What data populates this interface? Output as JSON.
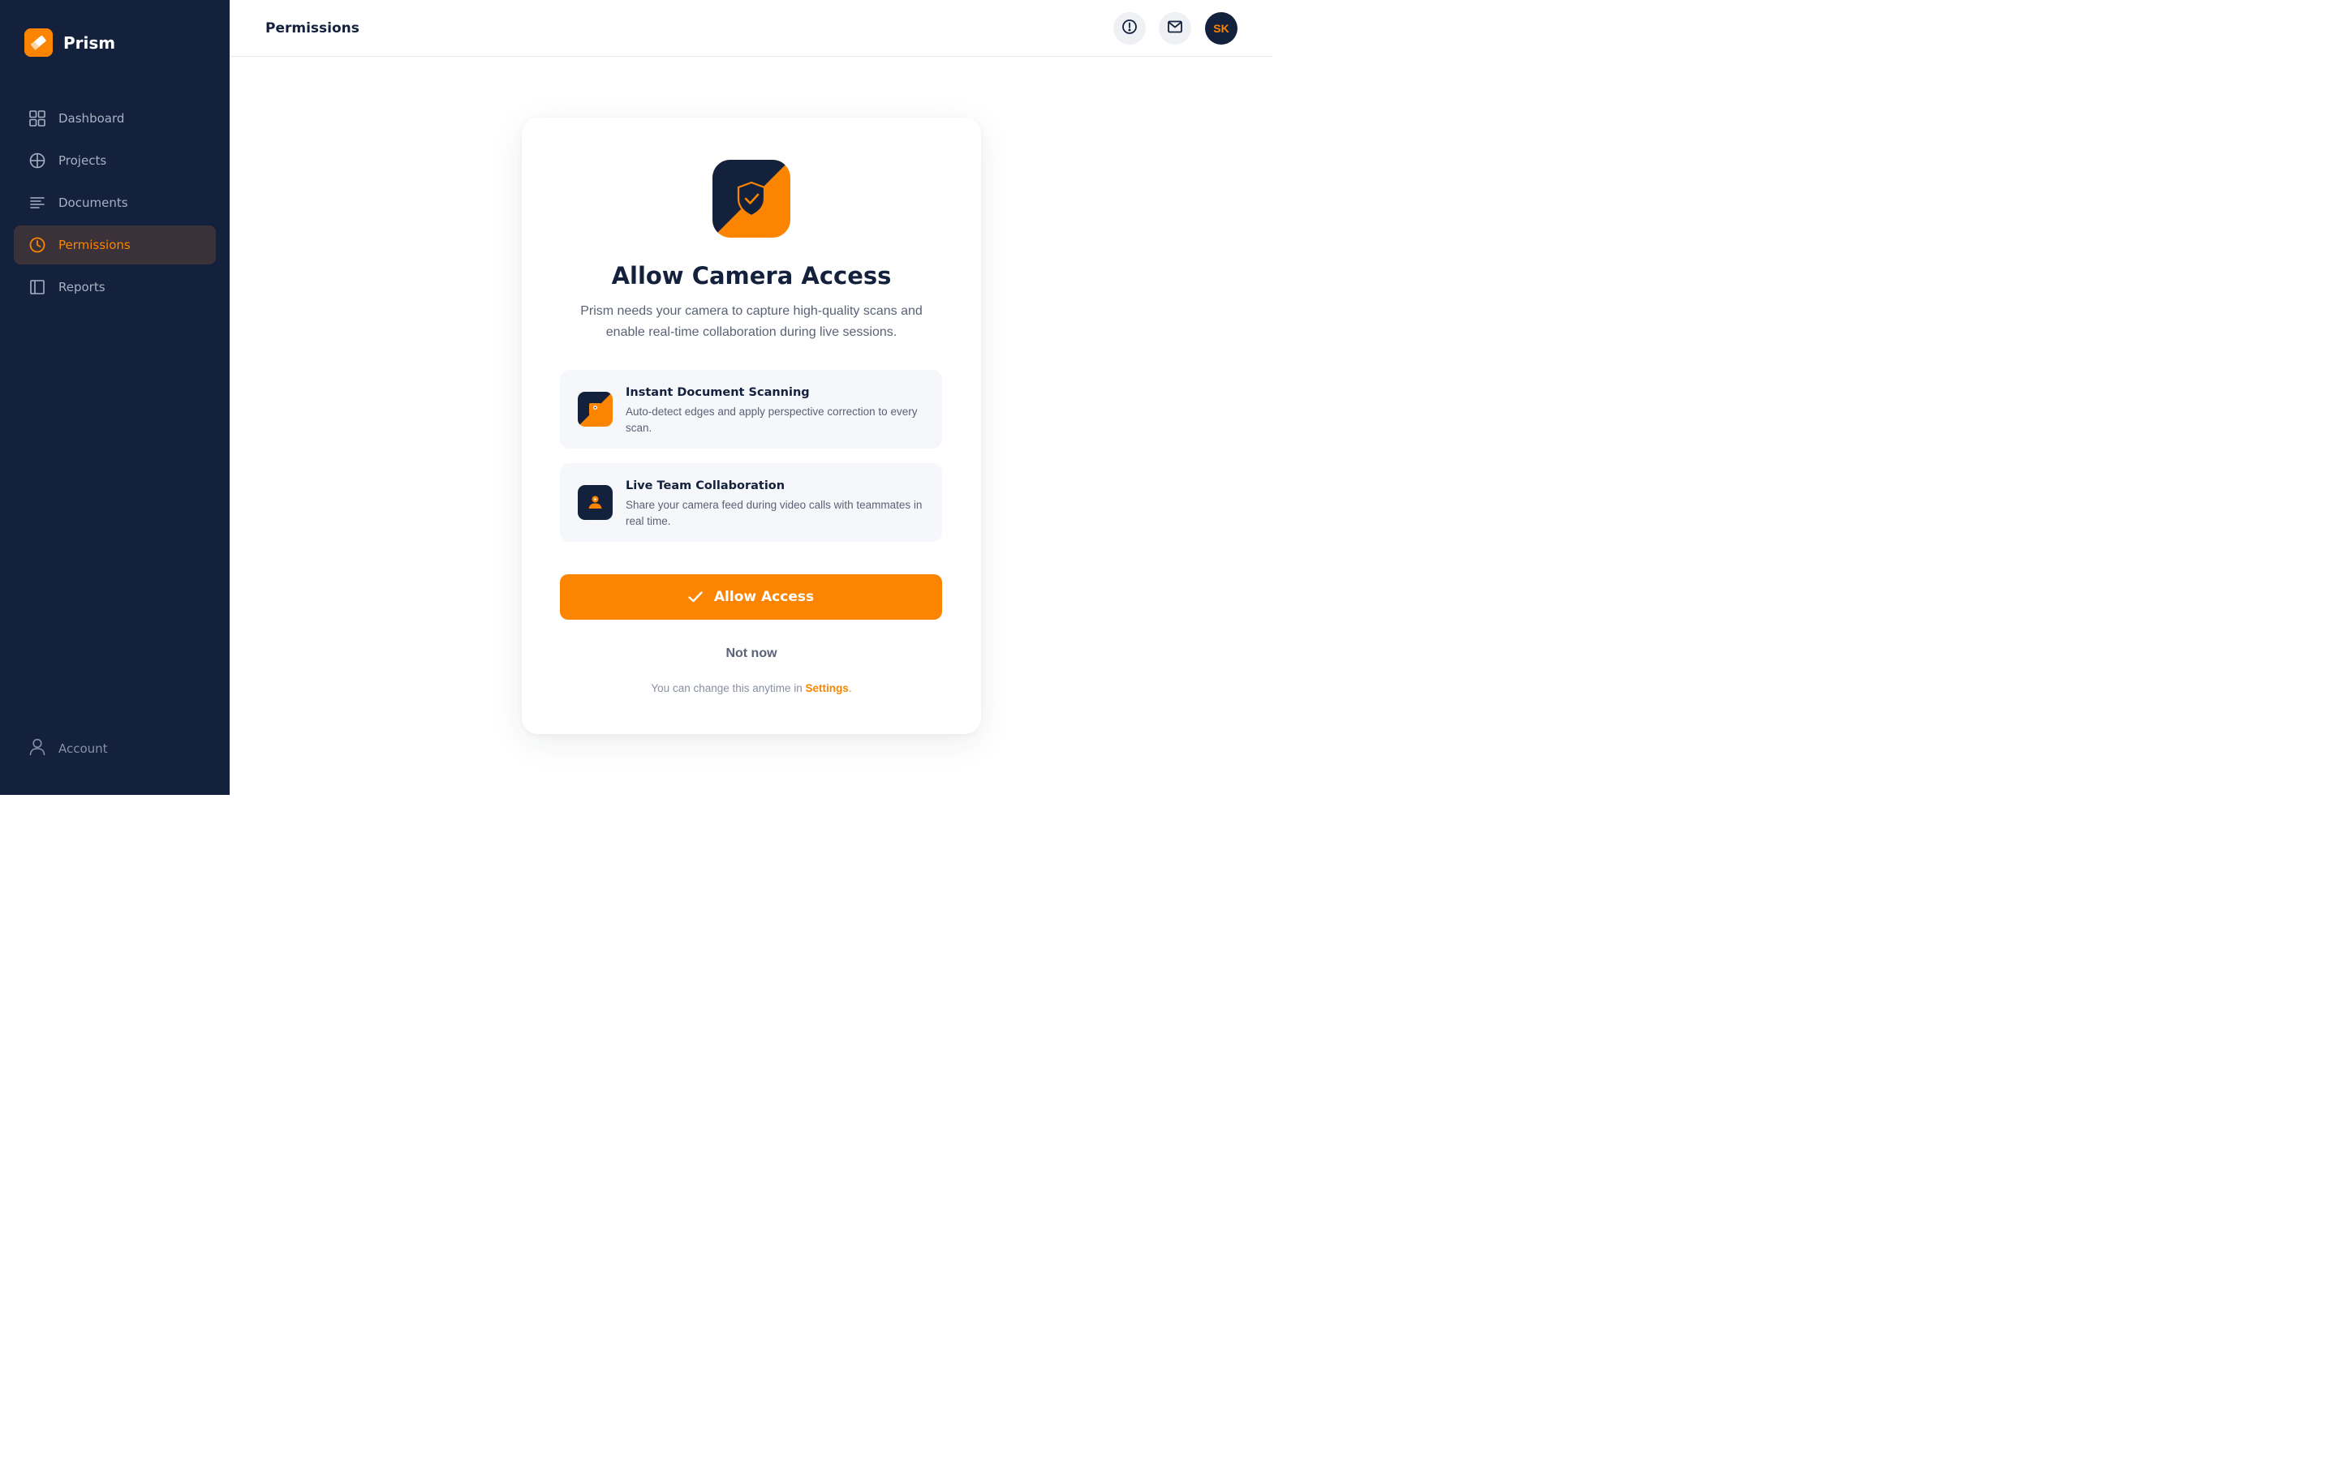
{
  "app": {
    "name": "Prism"
  },
  "sidebar": {
    "items": [
      {
        "label": "Dashboard",
        "icon": "grid-icon"
      },
      {
        "label": "Projects",
        "icon": "globe-icon"
      },
      {
        "label": "Documents",
        "icon": "lines-icon"
      },
      {
        "label": "Permissions",
        "icon": "clock-icon",
        "active": true
      },
      {
        "label": "Reports",
        "icon": "panel-icon"
      }
    ],
    "account_label": "Account"
  },
  "header": {
    "title": "Permissions",
    "avatar_initials": "SK"
  },
  "card": {
    "title": "Allow Camera Access",
    "description": "Prism needs your camera to capture high-quality scans and enable real-time collaboration during live sessions.",
    "features": [
      {
        "title": "Instant Document Scanning",
        "description": "Auto-detect edges and apply perspective correction to every scan."
      },
      {
        "title": "Live Team Collaboration",
        "description": "Share your camera feed during video calls with teammates in real time."
      }
    ],
    "allow_label": "Allow Access",
    "decline_label": "Not now",
    "footnote_prefix": "You can change this anytime in ",
    "footnote_link": "Settings",
    "footnote_suffix": "."
  },
  "colors": {
    "accent": "#fb8500",
    "navy": "#14213d",
    "sidebar_active_bg": "#3a3238"
  }
}
